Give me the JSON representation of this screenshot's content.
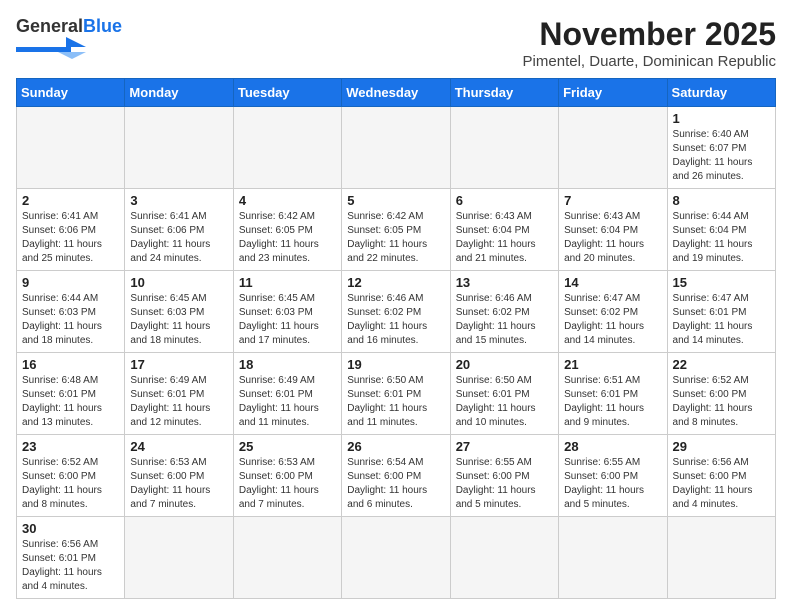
{
  "header": {
    "logo_general": "General",
    "logo_blue": "Blue",
    "month_title": "November 2025",
    "subtitle": "Pimentel, Duarte, Dominican Republic"
  },
  "days_of_week": [
    "Sunday",
    "Monday",
    "Tuesday",
    "Wednesday",
    "Thursday",
    "Friday",
    "Saturday"
  ],
  "weeks": [
    [
      {
        "day": "",
        "info": ""
      },
      {
        "day": "",
        "info": ""
      },
      {
        "day": "",
        "info": ""
      },
      {
        "day": "",
        "info": ""
      },
      {
        "day": "",
        "info": ""
      },
      {
        "day": "",
        "info": ""
      },
      {
        "day": "1",
        "info": "Sunrise: 6:40 AM\nSunset: 6:07 PM\nDaylight: 11 hours\nand 26 minutes."
      }
    ],
    [
      {
        "day": "2",
        "info": "Sunrise: 6:41 AM\nSunset: 6:06 PM\nDaylight: 11 hours\nand 25 minutes."
      },
      {
        "day": "3",
        "info": "Sunrise: 6:41 AM\nSunset: 6:06 PM\nDaylight: 11 hours\nand 24 minutes."
      },
      {
        "day": "4",
        "info": "Sunrise: 6:42 AM\nSunset: 6:05 PM\nDaylight: 11 hours\nand 23 minutes."
      },
      {
        "day": "5",
        "info": "Sunrise: 6:42 AM\nSunset: 6:05 PM\nDaylight: 11 hours\nand 22 minutes."
      },
      {
        "day": "6",
        "info": "Sunrise: 6:43 AM\nSunset: 6:04 PM\nDaylight: 11 hours\nand 21 minutes."
      },
      {
        "day": "7",
        "info": "Sunrise: 6:43 AM\nSunset: 6:04 PM\nDaylight: 11 hours\nand 20 minutes."
      },
      {
        "day": "8",
        "info": "Sunrise: 6:44 AM\nSunset: 6:04 PM\nDaylight: 11 hours\nand 19 minutes."
      }
    ],
    [
      {
        "day": "9",
        "info": "Sunrise: 6:44 AM\nSunset: 6:03 PM\nDaylight: 11 hours\nand 18 minutes."
      },
      {
        "day": "10",
        "info": "Sunrise: 6:45 AM\nSunset: 6:03 PM\nDaylight: 11 hours\nand 18 minutes."
      },
      {
        "day": "11",
        "info": "Sunrise: 6:45 AM\nSunset: 6:03 PM\nDaylight: 11 hours\nand 17 minutes."
      },
      {
        "day": "12",
        "info": "Sunrise: 6:46 AM\nSunset: 6:02 PM\nDaylight: 11 hours\nand 16 minutes."
      },
      {
        "day": "13",
        "info": "Sunrise: 6:46 AM\nSunset: 6:02 PM\nDaylight: 11 hours\nand 15 minutes."
      },
      {
        "day": "14",
        "info": "Sunrise: 6:47 AM\nSunset: 6:02 PM\nDaylight: 11 hours\nand 14 minutes."
      },
      {
        "day": "15",
        "info": "Sunrise: 6:47 AM\nSunset: 6:01 PM\nDaylight: 11 hours\nand 14 minutes."
      }
    ],
    [
      {
        "day": "16",
        "info": "Sunrise: 6:48 AM\nSunset: 6:01 PM\nDaylight: 11 hours\nand 13 minutes."
      },
      {
        "day": "17",
        "info": "Sunrise: 6:49 AM\nSunset: 6:01 PM\nDaylight: 11 hours\nand 12 minutes."
      },
      {
        "day": "18",
        "info": "Sunrise: 6:49 AM\nSunset: 6:01 PM\nDaylight: 11 hours\nand 11 minutes."
      },
      {
        "day": "19",
        "info": "Sunrise: 6:50 AM\nSunset: 6:01 PM\nDaylight: 11 hours\nand 11 minutes."
      },
      {
        "day": "20",
        "info": "Sunrise: 6:50 AM\nSunset: 6:01 PM\nDaylight: 11 hours\nand 10 minutes."
      },
      {
        "day": "21",
        "info": "Sunrise: 6:51 AM\nSunset: 6:01 PM\nDaylight: 11 hours\nand 9 minutes."
      },
      {
        "day": "22",
        "info": "Sunrise: 6:52 AM\nSunset: 6:00 PM\nDaylight: 11 hours\nand 8 minutes."
      }
    ],
    [
      {
        "day": "23",
        "info": "Sunrise: 6:52 AM\nSunset: 6:00 PM\nDaylight: 11 hours\nand 8 minutes."
      },
      {
        "day": "24",
        "info": "Sunrise: 6:53 AM\nSunset: 6:00 PM\nDaylight: 11 hours\nand 7 minutes."
      },
      {
        "day": "25",
        "info": "Sunrise: 6:53 AM\nSunset: 6:00 PM\nDaylight: 11 hours\nand 7 minutes."
      },
      {
        "day": "26",
        "info": "Sunrise: 6:54 AM\nSunset: 6:00 PM\nDaylight: 11 hours\nand 6 minutes."
      },
      {
        "day": "27",
        "info": "Sunrise: 6:55 AM\nSunset: 6:00 PM\nDaylight: 11 hours\nand 5 minutes."
      },
      {
        "day": "28",
        "info": "Sunrise: 6:55 AM\nSunset: 6:00 PM\nDaylight: 11 hours\nand 5 minutes."
      },
      {
        "day": "29",
        "info": "Sunrise: 6:56 AM\nSunset: 6:00 PM\nDaylight: 11 hours\nand 4 minutes."
      }
    ],
    [
      {
        "day": "30",
        "info": "Sunrise: 6:56 AM\nSunset: 6:01 PM\nDaylight: 11 hours\nand 4 minutes."
      },
      {
        "day": "",
        "info": ""
      },
      {
        "day": "",
        "info": ""
      },
      {
        "day": "",
        "info": ""
      },
      {
        "day": "",
        "info": ""
      },
      {
        "day": "",
        "info": ""
      },
      {
        "day": "",
        "info": ""
      }
    ]
  ]
}
